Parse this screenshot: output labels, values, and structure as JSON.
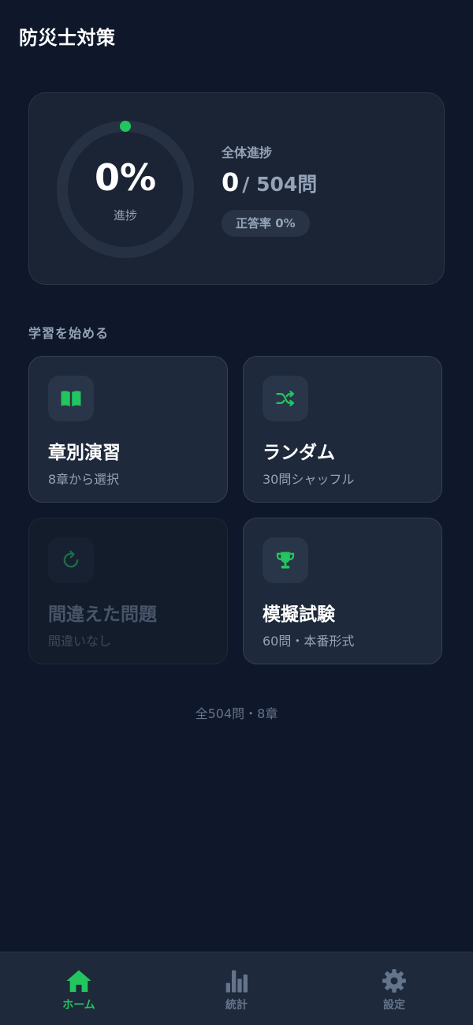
{
  "app": {
    "title": "防災士対策"
  },
  "progress": {
    "percent_text": "0%",
    "percent_value": 0,
    "ring_label": "進捗",
    "overall_label": "全体進捗",
    "answered": "0",
    "total_text": "/ 504問",
    "accuracy_text": "正答率 0%"
  },
  "section": {
    "title": "学習を始める"
  },
  "modes": [
    {
      "title": "章別演習",
      "subtitle": "8章から選択",
      "icon": "book-icon",
      "enabled": true
    },
    {
      "title": "ランダム",
      "subtitle": "30問シャッフル",
      "icon": "shuffle-icon",
      "enabled": true
    },
    {
      "title": "間違えた問題",
      "subtitle": "間違いなし",
      "icon": "retry-icon",
      "enabled": false
    },
    {
      "title": "模擬試験",
      "subtitle": "60問・本番形式",
      "icon": "trophy-icon",
      "enabled": true
    }
  ],
  "footer": {
    "note": "全504問・8章"
  },
  "tabs": [
    {
      "label": "ホーム",
      "icon": "home-icon",
      "active": true
    },
    {
      "label": "統計",
      "icon": "bar-chart-icon",
      "active": false
    },
    {
      "label": "設定",
      "icon": "gear-icon",
      "active": false
    }
  ],
  "colors": {
    "background": "#0f172a",
    "card": "#1e293b",
    "accent": "#22c55e",
    "muted_text": "#94a3b8"
  }
}
